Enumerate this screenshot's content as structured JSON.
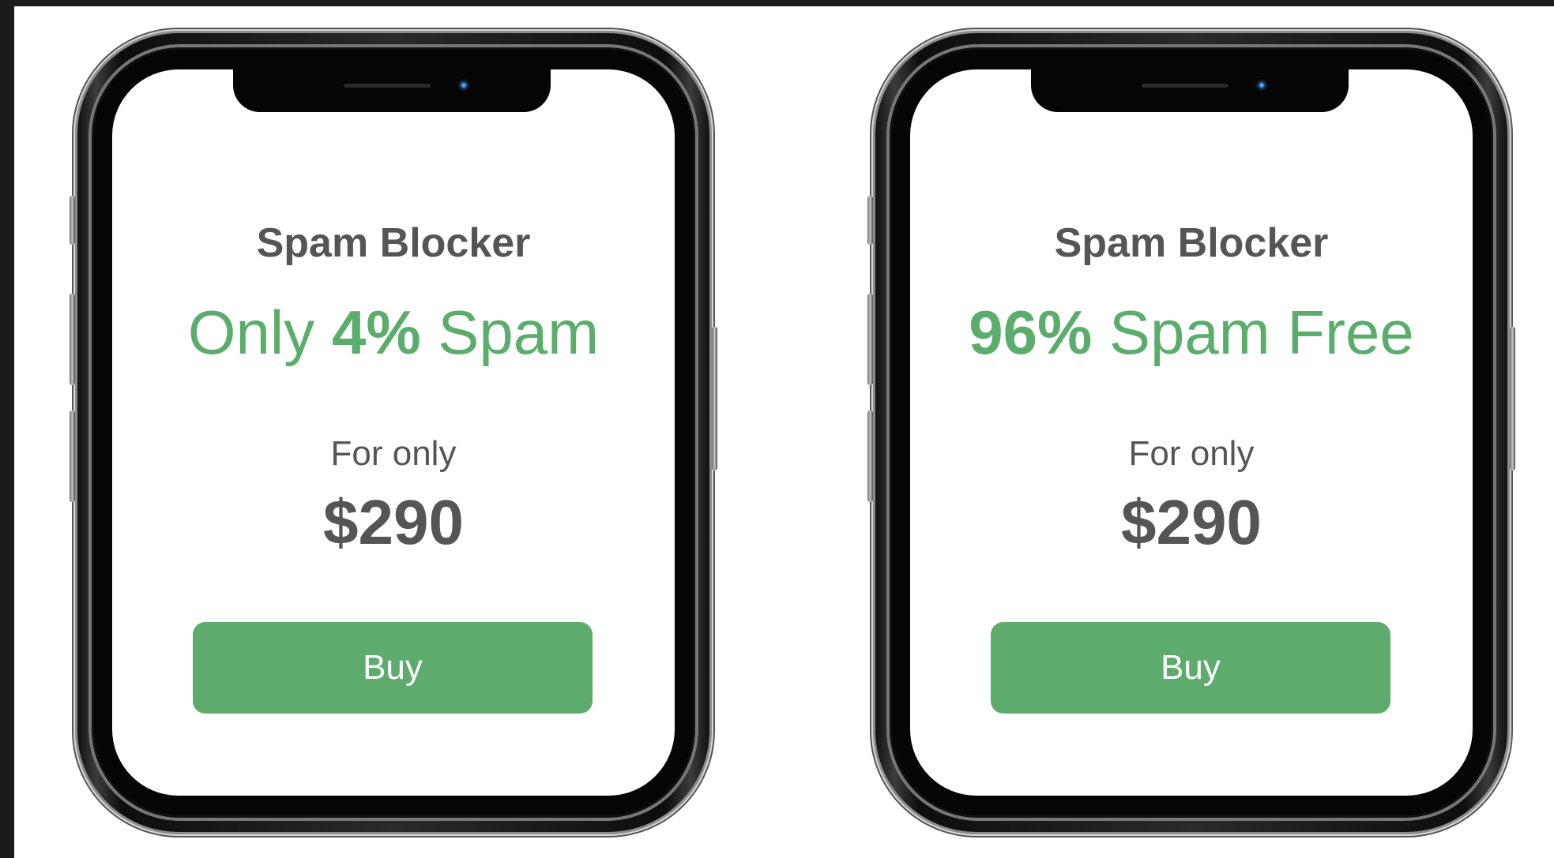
{
  "colors": {
    "accent_green": "#5bad6c",
    "text_gray": "#555555",
    "background_dark": "#1b1b1b",
    "screen_white": "#ffffff"
  },
  "phones": [
    {
      "app_name": "Spam Blocker",
      "headline_pre": "Only ",
      "headline_strong": "4%",
      "headline_post": " Spam",
      "price_label": "For only",
      "price": "$290",
      "button_label": "Buy"
    },
    {
      "app_name": "Spam Blocker",
      "headline_pre": "",
      "headline_strong": "96%",
      "headline_post": " Spam Free",
      "price_label": "For only",
      "price": "$290",
      "button_label": "Buy"
    }
  ]
}
